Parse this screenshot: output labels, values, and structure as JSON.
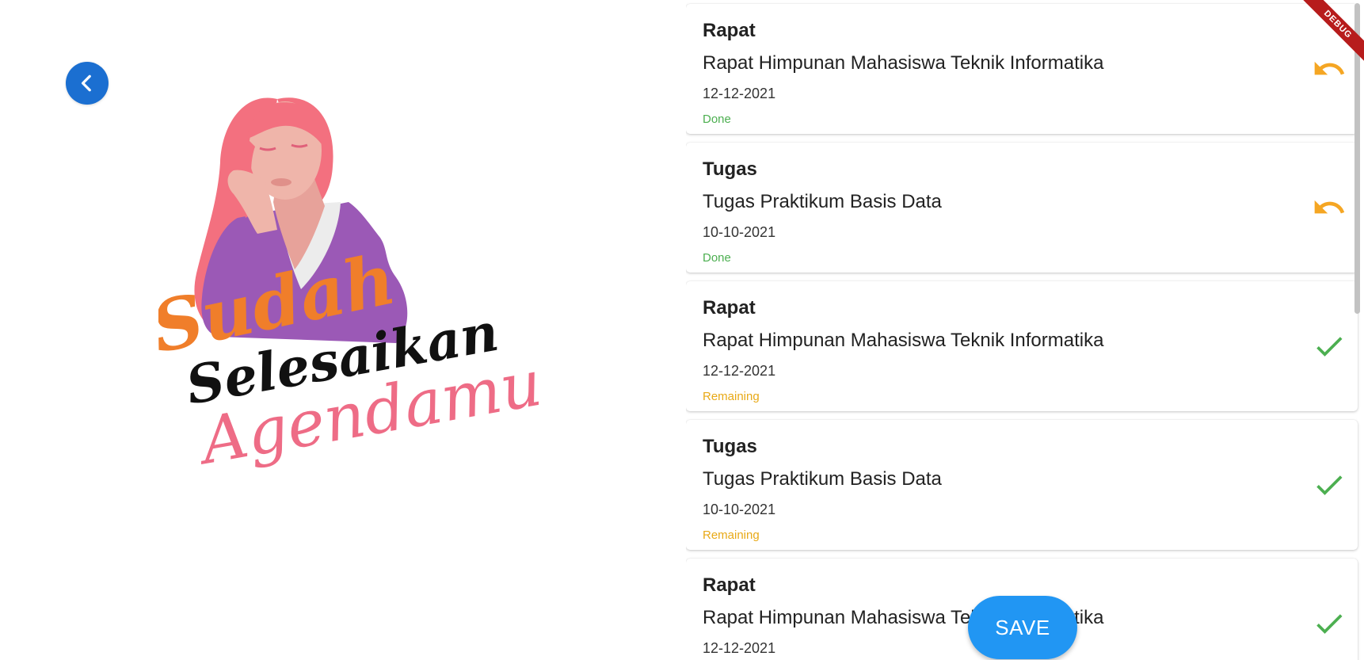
{
  "nav": {
    "back_icon": "chevron-left-icon"
  },
  "illustration": {
    "line1": "Sudah",
    "line2": "Selesaikan",
    "line3": "Agendamu?!"
  },
  "agenda": {
    "items": [
      {
        "category": "Rapat",
        "title": "Rapat Himpunan Mahasiswa Teknik Informatika",
        "date": "12-12-2021",
        "status": "Done",
        "action": "undo-icon"
      },
      {
        "category": "Tugas",
        "title": "Tugas Praktikum Basis Data",
        "date": "10-10-2021",
        "status": "Done",
        "action": "undo-icon"
      },
      {
        "category": "Rapat",
        "title": "Rapat Himpunan Mahasiswa Teknik Informatika",
        "date": "12-12-2021",
        "status": "Remaining",
        "action": "check-icon"
      },
      {
        "category": "Tugas",
        "title": "Tugas Praktikum Basis Data",
        "date": "10-10-2021",
        "status": "Remaining",
        "action": "check-icon"
      },
      {
        "category": "Rapat",
        "title": "Rapat Himpunan Mahasiswa Teknik Informatika",
        "date": "12-12-2021",
        "status": "",
        "action": "check-icon"
      }
    ]
  },
  "save_label": "SAVE",
  "debug_label": "DEBUG",
  "colors": {
    "primary": "#2196f3",
    "back_button": "#1b6fd1",
    "done": "#4caf50",
    "remaining": "#e8a917",
    "undo_icon": "#f5a623",
    "check_icon": "#4caf50"
  }
}
